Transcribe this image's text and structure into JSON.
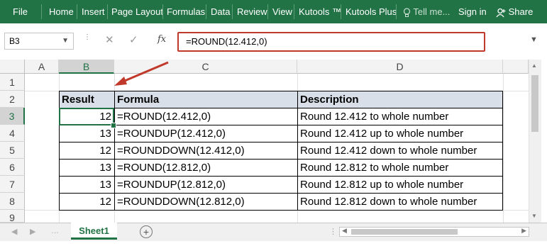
{
  "ribbon": {
    "tabs": [
      "File",
      "Home",
      "Insert",
      "Page Layout",
      "Formulas",
      "Data",
      "Review",
      "View",
      "Kutools ™",
      "Kutools Plus"
    ],
    "tell_me": "Tell me...",
    "sign_in": "Sign in",
    "share": "Share"
  },
  "formula_bar": {
    "name_box": "B3",
    "fx": "fx",
    "formula": "=ROUND(12.412,0)"
  },
  "grid": {
    "columns": [
      "A",
      "B",
      "C",
      "D"
    ],
    "rows": [
      "1",
      "2",
      "3",
      "4",
      "5",
      "6",
      "7",
      "8",
      "9"
    ],
    "selected_column": "B",
    "selected_row": "3"
  },
  "table": {
    "headers": [
      "Result",
      "Formula",
      "Description"
    ],
    "rows": [
      {
        "result": "12",
        "formula": "=ROUND(12.412,0)",
        "description": "Round 12.412 to whole number"
      },
      {
        "result": "13",
        "formula": "=ROUNDUP(12.412,0)",
        "description": "Round 12.412 up to whole number"
      },
      {
        "result": "12",
        "formula": "=ROUNDDOWN(12.412,0)",
        "description": "Round 12.412 down to whole number"
      },
      {
        "result": "13",
        "formula": "=ROUND(12.812,0)",
        "description": "Round 12.812 to whole number"
      },
      {
        "result": "13",
        "formula": "=ROUNDUP(12.812,0)",
        "description": "Round 12.812 up to whole number"
      },
      {
        "result": "12",
        "formula": "=ROUNDDOWN(12.812,0)",
        "description": "Round 12.812 down to whole number"
      }
    ]
  },
  "sheet_bar": {
    "sheet_name": "Sheet1"
  },
  "colors": {
    "ribbon": "#217346",
    "header_fill": "#d9dfe8",
    "highlight_border": "#c0392b",
    "active_cell": "#217346"
  }
}
